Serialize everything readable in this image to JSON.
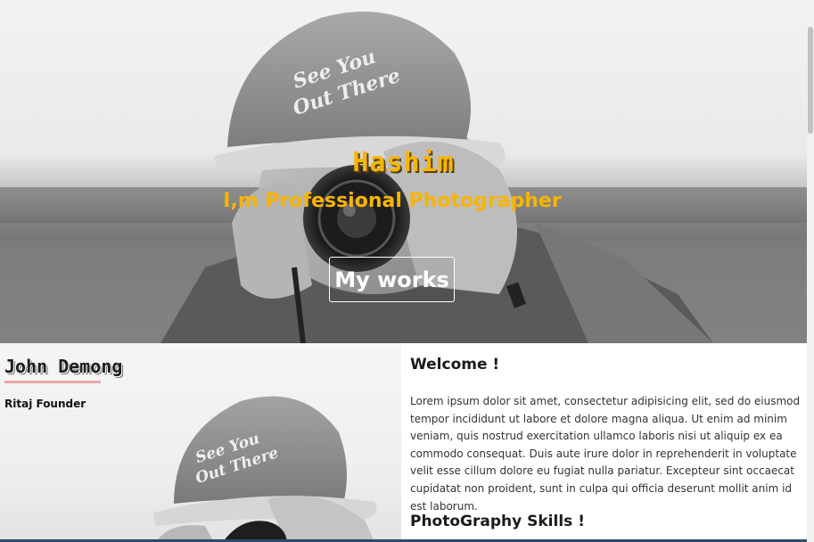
{
  "hero": {
    "name": "Hashim",
    "subtitle": "I,m Professional Photographer",
    "button_label": "My works",
    "cap_text_line1": "See You",
    "cap_text_line2": "Out There"
  },
  "profile": {
    "name": "John Demong",
    "role": "Ritaj Founder"
  },
  "welcome": {
    "heading": "Welcome !",
    "body": "Lorem ipsum dolor sit amet, consectetur adipisicing elit, sed do eiusmod tempor incididunt ut labore et dolore magna aliqua. Ut enim ad minim veniam, quis nostrud exercitation ullamco laboris nisi ut aliquip ex ea commodo consequat. Duis aute irure dolor in reprehenderit in voluptate velit esse cillum dolore eu fugiat nulla pariatur. Excepteur sint occaecat cupidatat non proident, sunt in culpa qui officia deserunt mollit anim id est laborum."
  },
  "skills": {
    "heading": "PhotoGraphy Skills !"
  },
  "colors": {
    "accent": "#f7b500",
    "underline": "#e8a7a7"
  }
}
